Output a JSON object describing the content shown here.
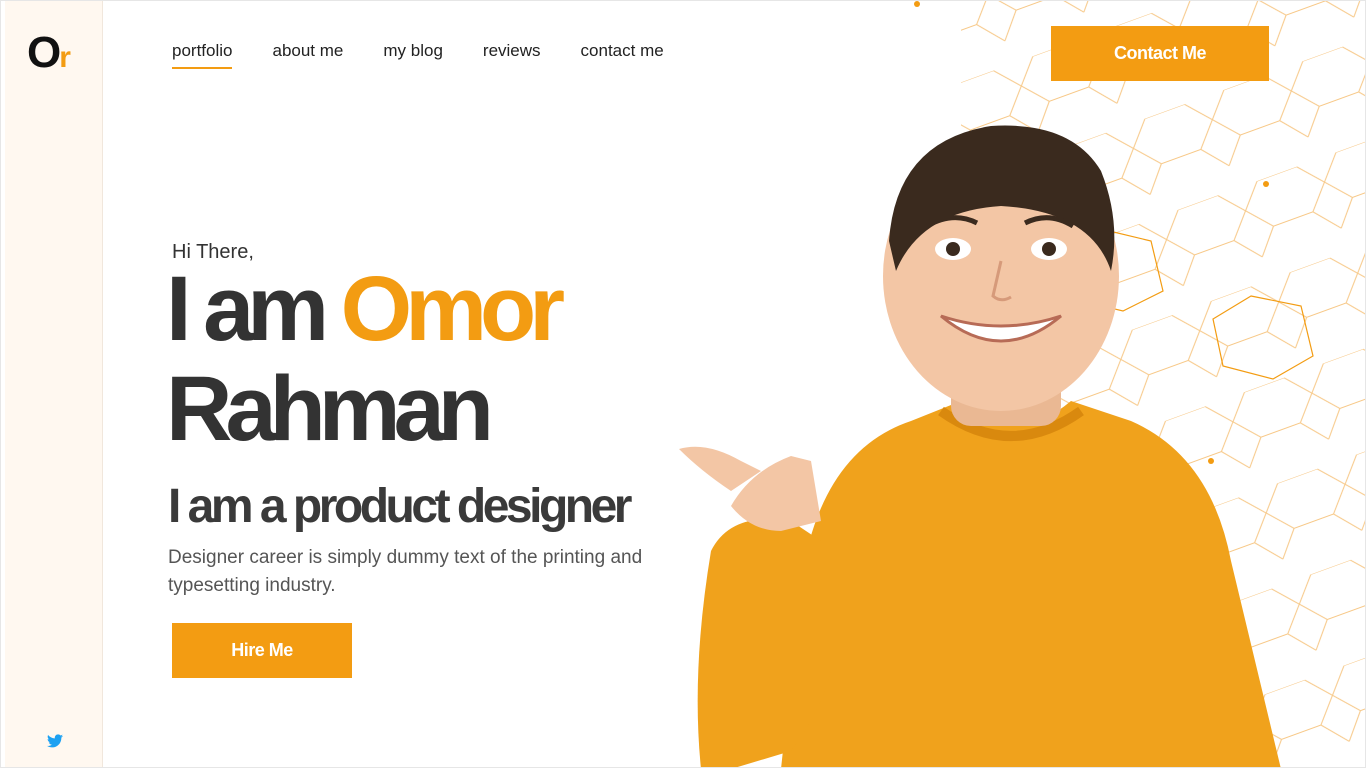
{
  "logo": {
    "primary": "O",
    "secondary": "r"
  },
  "nav": {
    "items": [
      {
        "label": "portfolio",
        "active": true
      },
      {
        "label": "about me",
        "active": false
      },
      {
        "label": "my blog",
        "active": false
      },
      {
        "label": "reviews",
        "active": false
      },
      {
        "label": "contact me",
        "active": false
      }
    ]
  },
  "header": {
    "contact_button": "Contact Me"
  },
  "hero": {
    "greeting": "Hi There,",
    "name_prefix": "I am",
    "first_name": "Omor",
    "last_name": "Rahman",
    "subtitle": "I am a product designer",
    "description": "Designer career is simply dummy text of the printing and typesetting industry.",
    "hire_button": "Hire Me"
  },
  "social": {
    "icon": "twitter-icon"
  },
  "colors": {
    "accent": "#f39c12",
    "text_dark": "#333333",
    "rail_bg": "#fff8f0",
    "twitter": "#1da1f2"
  }
}
